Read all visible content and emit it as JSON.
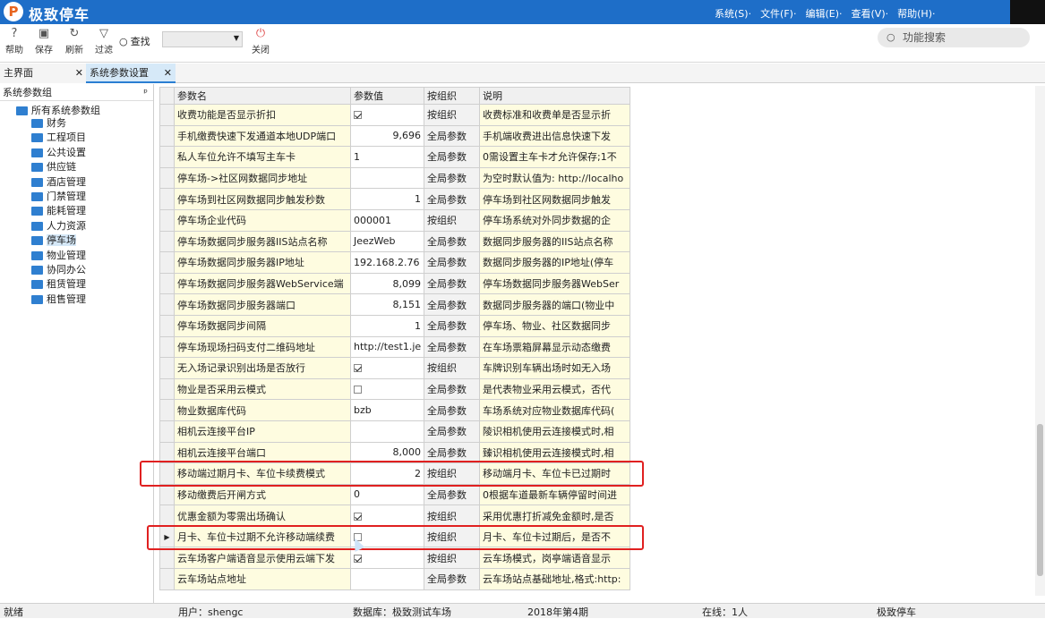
{
  "app": {
    "logo": "P",
    "title": "极致停车"
  },
  "menu": [
    "系统(S)·",
    "文件(F)·",
    "编辑(E)·",
    "查看(V)·",
    "帮助(H)·"
  ],
  "toolbar": {
    "help": "帮助",
    "save": "保存",
    "refresh": "刷新",
    "filter": "过滤",
    "search": "查找",
    "close": "关闭",
    "func_search": "功能搜索"
  },
  "tabs": {
    "main": "主界面",
    "sys": "系统参数设置",
    "close": "✕"
  },
  "left": {
    "header": "系统参数组",
    "pin": "ᵖ",
    "root": "所有系统参数组",
    "items": [
      "财务",
      "工程项目",
      "公共设置",
      "供应链",
      "酒店管理",
      "门禁管理",
      "能耗管理",
      "人力资源",
      "停车场",
      "物业管理",
      "协同办公",
      "租赁管理",
      "租售管理"
    ],
    "selected": "停车场"
  },
  "grid": {
    "headers": [
      "参数名",
      "参数值",
      "按组织",
      "说明"
    ],
    "rows": [
      {
        "name": "收费功能是否显示折扣",
        "value": "",
        "check": true,
        "scope": "按组织",
        "desc": "收费标准和收费单是否显示折"
      },
      {
        "name": "手机缴费快速下发通道本地UDP端口",
        "value": "9,696",
        "num": true,
        "scope": "全局参数",
        "desc": "手机端收费进出信息快速下发"
      },
      {
        "name": "私人车位允许不填写主车卡",
        "value": "1",
        "scope": "全局参数",
        "desc": "0需设置主车卡才允许保存;1不"
      },
      {
        "name": "停车场->社区网数据同步地址",
        "value": "",
        "scope": "全局参数",
        "desc": "为空时默认值为: http://localho"
      },
      {
        "name": "停车场到社区网数据同步触发秒数",
        "value": "1",
        "num": true,
        "scope": "全局参数",
        "desc": "停车场到社区网数据同步触发"
      },
      {
        "name": "停车场企业代码",
        "value": "000001",
        "scope": "按组织",
        "desc": "停车场系统对外同步数据的企"
      },
      {
        "name": "停车场数据同步服务器IIS站点名称",
        "value": "JeezWeb",
        "scope": "全局参数",
        "desc": "数据同步服务器的IIS站点名称"
      },
      {
        "name": "停车场数据同步服务器IP地址",
        "value": "192.168.2.76",
        "scope": "全局参数",
        "desc": "数据同步服务器的IP地址(停车"
      },
      {
        "name": "停车场数据同步服务器WebService端",
        "value": "8,099",
        "num": true,
        "scope": "全局参数",
        "desc": "停车场数据同步服务器WebSer"
      },
      {
        "name": "停车场数据同步服务器端口",
        "value": "8,151",
        "num": true,
        "scope": "全局参数",
        "desc": "数据同步服务器的端口(物业中"
      },
      {
        "name": "停车场数据同步间隔",
        "value": "1",
        "num": true,
        "scope": "全局参数",
        "desc": "停车场、物业、社区数据同步"
      },
      {
        "name": "停车场现场扫码支付二维码地址",
        "value": "http://test1.je",
        "scope": "全局参数",
        "desc": "在车场票箱屏幕显示动态缴费"
      },
      {
        "name": "无入场记录识别出场是否放行",
        "value": "",
        "check": true,
        "scope": "按组织",
        "desc": "车牌识别车辆出场时如无入场"
      },
      {
        "name": "物业是否采用云模式",
        "value": "",
        "check": false,
        "scope": "全局参数",
        "desc": "是代表物业采用云模式，否代"
      },
      {
        "name": "物业数据库代码",
        "value": "bzb",
        "scope": "全局参数",
        "desc": "车场系统对应物业数据库代码("
      },
      {
        "name": "相机云连接平台IP",
        "value": "",
        "scope": "全局参数",
        "desc": "陵识相机使用云连接模式时,相"
      },
      {
        "name": "相机云连接平台端口",
        "value": "8,000",
        "num": true,
        "scope": "全局参数",
        "desc": "臻识相机使用云连接模式时,相"
      },
      {
        "name": "移动端过期月卡、车位卡续费模式",
        "value": "2",
        "num": true,
        "scope": "按组织",
        "desc": "移动端月卡、车位卡已过期时"
      },
      {
        "name": "移动缴费后开闸方式",
        "value": "0",
        "scope": "全局参数",
        "desc": "0根据车道最新车辆停留时间进"
      },
      {
        "name": "优惠金额为零需出场确认",
        "value": "",
        "check": true,
        "scope": "按组织",
        "desc": "采用优惠打折减免金额时,是否"
      },
      {
        "name": "月卡、车位卡过期不允许移动端续费",
        "value": "",
        "check": false,
        "scope": "按组织",
        "desc": "月卡、车位卡过期后，是否不",
        "current": true
      },
      {
        "name": "云车场客户端语音显示使用云端下发",
        "value": "",
        "check": true,
        "scope": "按组织",
        "desc": "云车场模式，岗亭端语音显示"
      },
      {
        "name": "云车场站点地址",
        "value": "",
        "scope": "全局参数",
        "desc": "云车场站点基础地址,格式:http:"
      }
    ]
  },
  "status": {
    "ready": "就绪",
    "user": "用户：shengc",
    "db": "数据库：极致测试车场",
    "period": "2018年第4期",
    "online": "在线：1人",
    "brand": "极致停车"
  },
  "colors": {
    "titlebar": "#1e6ec8",
    "highlight": "#e02020",
    "name_bg": "#fefce0"
  }
}
